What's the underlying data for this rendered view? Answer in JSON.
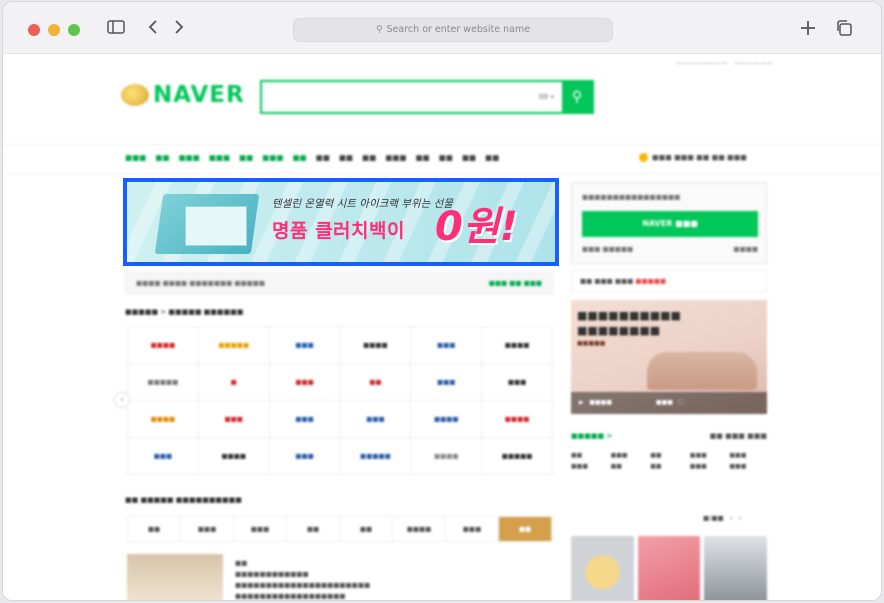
{
  "browser": {
    "address_placeholder": "Search or enter website name",
    "icons": [
      "sidebar-icon",
      "back-icon",
      "forward-icon",
      "new-tab-icon",
      "tabs-overview-icon"
    ]
  },
  "banner": {
    "subtitle": "텐셀린 온열력 시트 아이크랙 부위는 선물",
    "headline": "명품 클러치백이",
    "price": "0원!"
  },
  "colors": {
    "naver_green": "#03c75a",
    "banner_highlight_border": "#1660ff",
    "banner_pink": "#ff2f77"
  }
}
